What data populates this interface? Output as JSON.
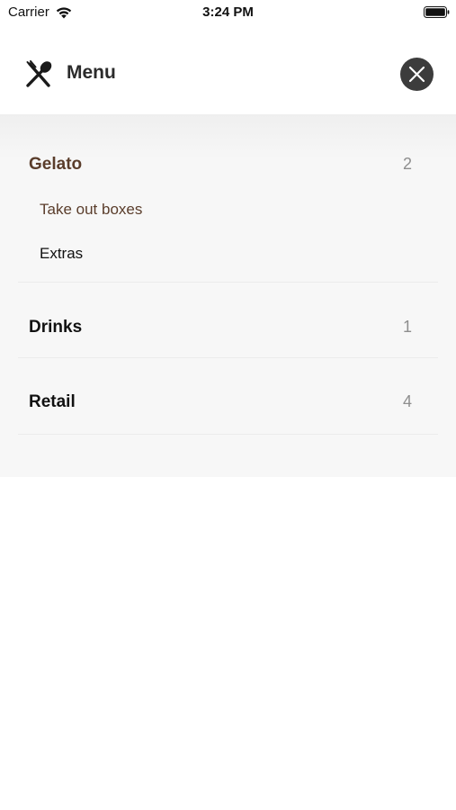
{
  "status_bar": {
    "carrier": "Carrier",
    "time": "3:24 PM",
    "icons": [
      "wifi-icon",
      "battery-icon"
    ]
  },
  "header": {
    "title": "Menu",
    "icon": "cutlery-icon",
    "close_icon": "close-icon"
  },
  "menu": {
    "categories": [
      {
        "label": "Gelato",
        "count": "2",
        "active": true,
        "subitems": [
          {
            "label": "Take out boxes",
            "active": true
          },
          {
            "label": "Extras",
            "active": false
          }
        ]
      },
      {
        "label": "Drinks",
        "count": "1",
        "active": false
      },
      {
        "label": "Retail",
        "count": "4",
        "active": false
      }
    ]
  },
  "colors": {
    "active_text": "#5a3d2b",
    "panel_background": "#f7f7f7",
    "close_button": "#3c3c3c",
    "count_text": "#8e8e8e"
  }
}
